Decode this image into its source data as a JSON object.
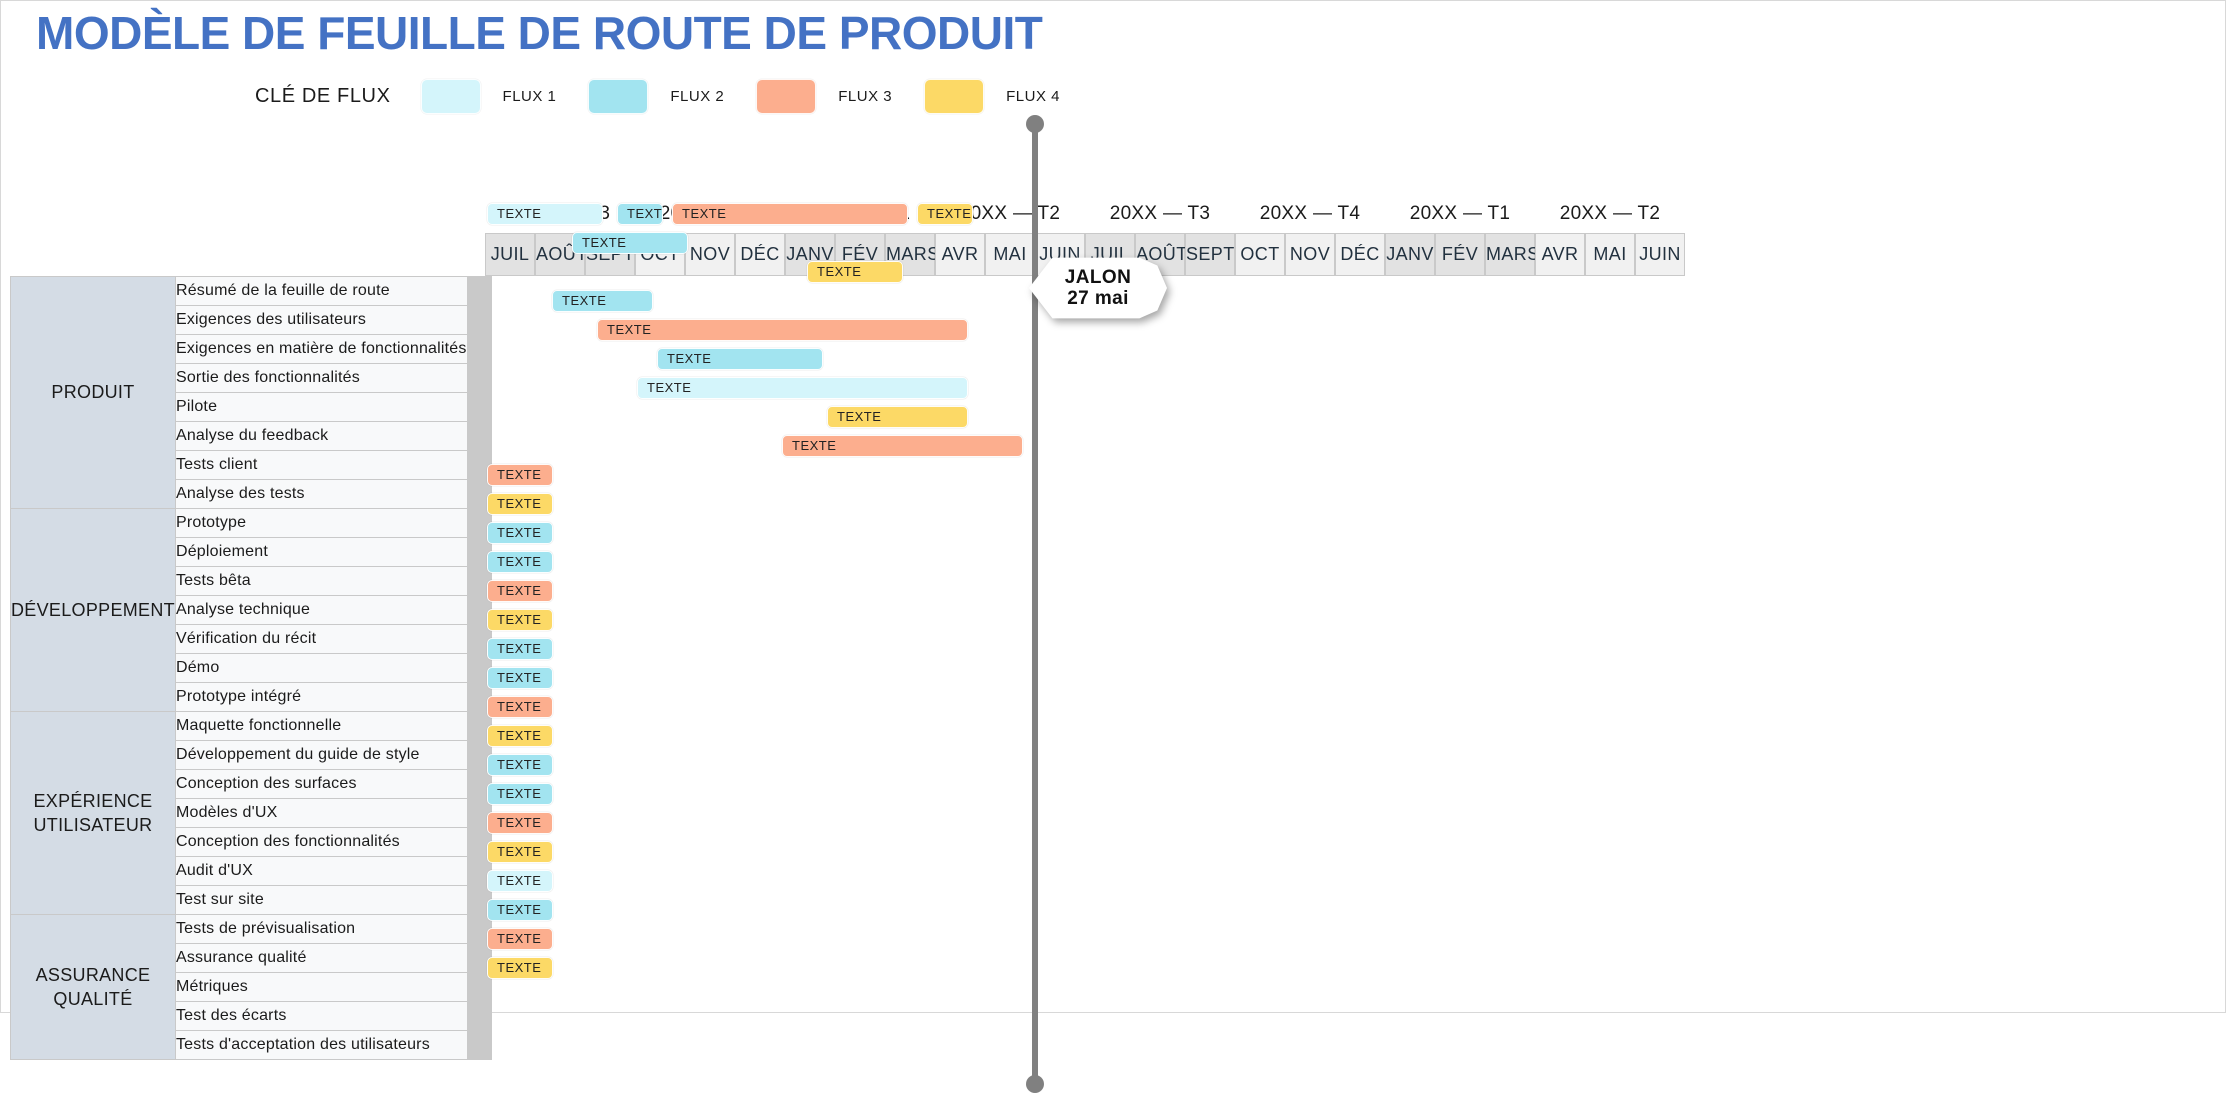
{
  "title": "MODÈLE DE FEUILLE DE ROUTE DE PRODUIT",
  "legend": {
    "key_label": "CLÉ DE FLUX",
    "items": [
      {
        "label": "FLUX 1",
        "color": "#d4f5fb"
      },
      {
        "label": "FLUX 2",
        "color": "#a2e4f0"
      },
      {
        "label": "FLUX 3",
        "color": "#fcae8e"
      },
      {
        "label": "FLUX 4",
        "color": "#fcd966"
      }
    ]
  },
  "timeline": {
    "quarters": [
      {
        "label": "20XX — T3",
        "shade": "dark"
      },
      {
        "label": "20XX — T4",
        "shade": "light"
      },
      {
        "label": "20XX — T1",
        "shade": "dark"
      },
      {
        "label": "20XX — T2",
        "shade": "light"
      },
      {
        "label": "20XX — T3",
        "shade": "dark"
      },
      {
        "label": "20XX — T4",
        "shade": "light"
      },
      {
        "label": "20XX — T1",
        "shade": "dark"
      },
      {
        "label": "20XX — T2",
        "shade": "light"
      }
    ],
    "months": [
      "JUIL",
      "AOÛT",
      "SEPT",
      "OCT",
      "NOV",
      "DÉC",
      "JANV",
      "FÉV",
      "MARS",
      "AVR",
      "MAI",
      "JUIN",
      "JUIL",
      "AOÛT",
      "SEPT",
      "OCT",
      "NOV",
      "DÉC",
      "JANV",
      "FÉV",
      "MARS",
      "AVR",
      "MAI",
      "JUIN"
    ]
  },
  "milestone": {
    "line1": "JALON",
    "line2": "27 mai",
    "month_index": 10,
    "color": "#808080"
  },
  "bar_text": "TEXTE",
  "sections": [
    {
      "category": "PRODUIT",
      "rows": [
        {
          "task": "Résumé de la feuille de route",
          "bars": [
            {
              "start": 0,
              "span": 2.4,
              "flux": 1
            },
            {
              "start": 2.6,
              "span": 1.0,
              "flux": 2
            },
            {
              "start": 3.7,
              "span": 4.8,
              "flux": 3
            },
            {
              "start": 8.6,
              "span": 1.2,
              "flux": 4
            }
          ]
        },
        {
          "task": "Exigences des utilisateurs",
          "bars": [
            {
              "start": 1.7,
              "span": 2.4,
              "flux": 2
            }
          ]
        },
        {
          "task": "Exigences en matière de fonctionnalités",
          "bars": [
            {
              "start": 6.4,
              "span": 2.0,
              "flux": 4
            }
          ]
        },
        {
          "task": "Sortie des fonctionnalités",
          "bars": [
            {
              "start": 1.3,
              "span": 2.1,
              "flux": 2
            }
          ]
        },
        {
          "task": "Pilote",
          "bars": [
            {
              "start": 2.2,
              "span": 7.5,
              "flux": 3
            }
          ]
        },
        {
          "task": "Analyse du feedback",
          "bars": [
            {
              "start": 3.4,
              "span": 3.4,
              "flux": 2
            }
          ]
        },
        {
          "task": "Tests client",
          "bars": [
            {
              "start": 3.0,
              "span": 6.7,
              "flux": 1
            }
          ]
        },
        {
          "task": "Analyse des tests",
          "bars": [
            {
              "start": 6.8,
              "span": 2.9,
              "flux": 4
            }
          ]
        }
      ]
    },
    {
      "category": "DÉVELOPPEMENT",
      "rows": [
        {
          "task": "Prototype",
          "bars": [
            {
              "start": 5.9,
              "span": 4.9,
              "flux": 3
            }
          ]
        },
        {
          "task": "Déploiement",
          "bars": [
            {
              "start": 0,
              "span": 1.4,
              "flux": 3
            }
          ]
        },
        {
          "task": "Tests bêta",
          "bars": [
            {
              "start": 0,
              "span": 1.4,
              "flux": 4
            }
          ]
        },
        {
          "task": "Analyse technique",
          "bars": [
            {
              "start": 0,
              "span": 1.4,
              "flux": 2
            }
          ]
        },
        {
          "task": "Vérification du récit",
          "bars": [
            {
              "start": 0,
              "span": 1.4,
              "flux": 2
            }
          ]
        },
        {
          "task": "Démo",
          "bars": [
            {
              "start": 0,
              "span": 1.4,
              "flux": 3
            }
          ]
        },
        {
          "task": "Prototype intégré",
          "bars": [
            {
              "start": 0,
              "span": 1.4,
              "flux": 4
            }
          ]
        }
      ]
    },
    {
      "category": "EXPÉRIENCE UTILISATEUR",
      "rows": [
        {
          "task": "Maquette fonctionnelle",
          "bars": [
            {
              "start": 0,
              "span": 1.4,
              "flux": 2
            }
          ]
        },
        {
          "task": "Développement du guide de style",
          "bars": [
            {
              "start": 0,
              "span": 1.4,
              "flux": 2
            }
          ]
        },
        {
          "task": "Conception des surfaces",
          "bars": [
            {
              "start": 0,
              "span": 1.4,
              "flux": 3
            }
          ]
        },
        {
          "task": "Modèles d'UX",
          "bars": [
            {
              "start": 0,
              "span": 1.4,
              "flux": 4
            }
          ]
        },
        {
          "task": "Conception des fonctionnalités",
          "bars": [
            {
              "start": 0,
              "span": 1.4,
              "flux": 2
            }
          ]
        },
        {
          "task": "Audit d'UX",
          "bars": [
            {
              "start": 0,
              "span": 1.4,
              "flux": 2
            }
          ]
        },
        {
          "task": "Test sur site",
          "bars": [
            {
              "start": 0,
              "span": 1.4,
              "flux": 3
            }
          ]
        }
      ]
    },
    {
      "category": "ASSURANCE QUALITÉ",
      "rows": [
        {
          "task": "Tests de prévisualisation",
          "bars": [
            {
              "start": 0,
              "span": 1.4,
              "flux": 4
            }
          ]
        },
        {
          "task": "Assurance qualité",
          "bars": [
            {
              "start": 0,
              "span": 1.4,
              "flux": 1
            }
          ]
        },
        {
          "task": "Métriques",
          "bars": [
            {
              "start": 0,
              "span": 1.4,
              "flux": 2
            }
          ]
        },
        {
          "task": "Test des écarts",
          "bars": [
            {
              "start": 0,
              "span": 1.4,
              "flux": 3
            }
          ]
        },
        {
          "task": "Tests d'acceptation des utilisateurs",
          "bars": [
            {
              "start": 0,
              "span": 1.4,
              "flux": 4
            }
          ]
        }
      ]
    }
  ]
}
